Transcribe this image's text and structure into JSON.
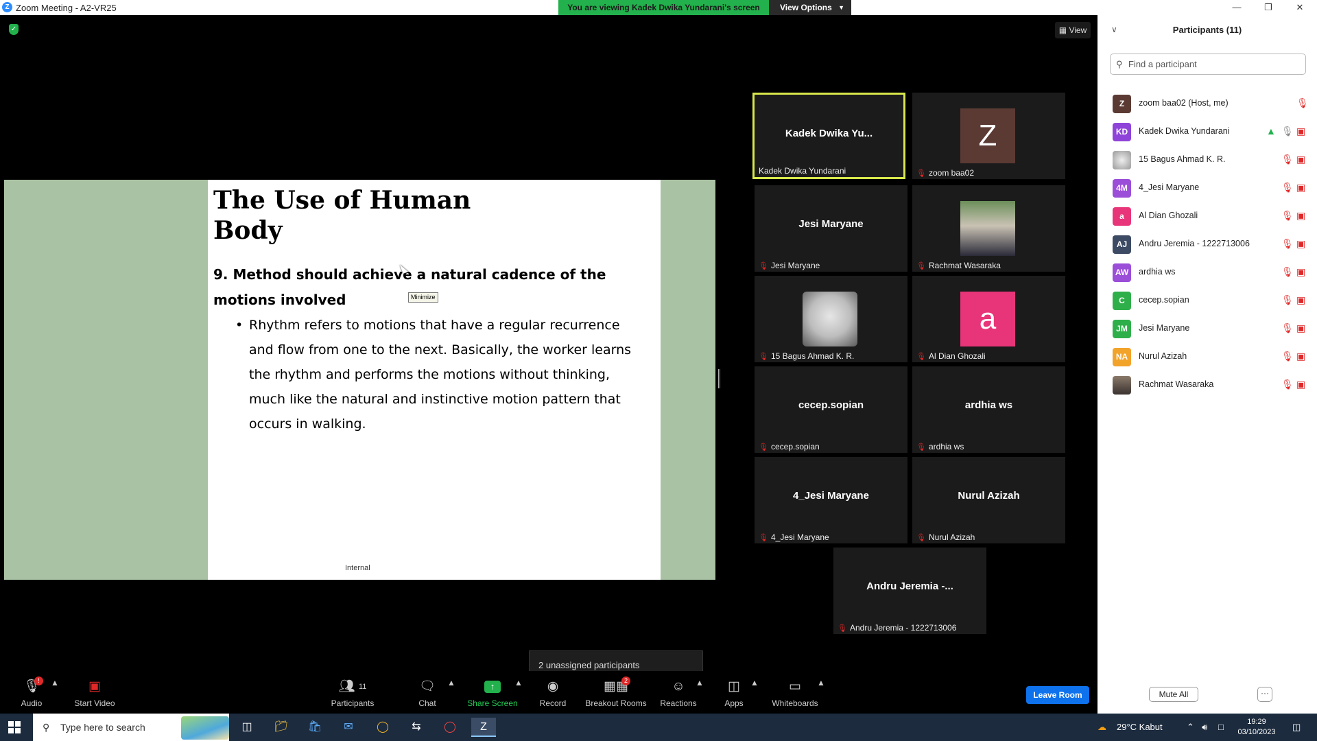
{
  "window": {
    "title": "Zoom Meeting - A2-VR25",
    "viewing_banner": "You are viewing Kadek Dwika Yundarani's screen",
    "view_options": "View Options"
  },
  "main": {
    "view_label": "View"
  },
  "slide": {
    "title": "The Use of Human Body",
    "subtitle": "9. Method should achieve a natural cadence of the motions involved",
    "bullet": "Rhythm refers to motions that have a regular recurrence and flow from one to the next. Basically, the worker learns the rhythm and performs the motions without thinking, much like the natural and instinctive motion pattern that occurs in walking.",
    "footer": "Internal",
    "tooltip": "Minimize"
  },
  "tiles": [
    {
      "display": "Kadek  Dwika  Yu...",
      "label": "Kadek Dwika Yundarani",
      "muted": false
    },
    {
      "display": "Z",
      "label": "zoom baa02",
      "muted": true,
      "avatar_color": "#5B3A33"
    },
    {
      "display": "Jesi Maryane",
      "label": "Jesi Maryane",
      "muted": true
    },
    {
      "display": "",
      "label": "Rachmat Wasaraka",
      "muted": true
    },
    {
      "display": "",
      "label": "15 Bagus Ahmad K. R.",
      "muted": true
    },
    {
      "display": "a",
      "label": "Al Dian Ghozali",
      "muted": true,
      "avatar_color": "#E8357A"
    },
    {
      "display": "cecep.sopian",
      "label": "cecep.sopian",
      "muted": true
    },
    {
      "display": "ardhia ws",
      "label": "ardhia ws",
      "muted": true
    },
    {
      "display": "4_Jesi Maryane",
      "label": "4_Jesi Maryane",
      "muted": true
    },
    {
      "display": "Nurul Azizah",
      "label": "Nurul Azizah",
      "muted": true
    },
    {
      "display": "Andru Jeremia -...",
      "label": "Andru Jeremia - 1222713006",
      "muted": true
    }
  ],
  "popup": {
    "unassigned": "2 unassigned participants"
  },
  "toolbar": {
    "audio": "Audio",
    "audio_badge": "!",
    "start_video": "Start Video",
    "participants": "Participants",
    "participants_count": "11",
    "chat": "Chat",
    "share_screen": "Share Screen",
    "record": "Record",
    "breakout": "Breakout Rooms",
    "breakout_badge": "2",
    "reactions": "Reactions",
    "apps": "Apps",
    "whiteboards": "Whiteboards",
    "leave": "Leave Room"
  },
  "panel": {
    "title": "Participants (11)",
    "search_placeholder": "Find a participant",
    "participants": [
      {
        "initials": "Z",
        "name": "zoom baa02 (Host, me)",
        "color": "#5B3A33"
      },
      {
        "initials": "KD",
        "name": "Kadek Dwika Yundarani",
        "color": "#8E44D8"
      },
      {
        "initials": "",
        "name": "15 Bagus Ahmad K. R.",
        "color": "#c9c9c9"
      },
      {
        "initials": "4M",
        "name": "4_Jesi Maryane",
        "color": "#9B4ED8"
      },
      {
        "initials": "a",
        "name": "Al Dian Ghozali",
        "color": "#E8357A"
      },
      {
        "initials": "AJ",
        "name": "Andru Jeremia - 1222713006",
        "color": "#3C4A63"
      },
      {
        "initials": "AW",
        "name": "ardhia ws",
        "color": "#9B4ED8"
      },
      {
        "initials": "C",
        "name": "cecep.sopian",
        "color": "#2FAF4A"
      },
      {
        "initials": "JM",
        "name": "Jesi Maryane",
        "color": "#2FAF4A"
      },
      {
        "initials": "NA",
        "name": "Nurul Azizah",
        "color": "#F2A32A"
      },
      {
        "initials": "",
        "name": "Rachmat Wasaraka",
        "color": "#6a5a50"
      }
    ],
    "mute_all": "Mute All",
    "more": "···"
  },
  "taskbar": {
    "search_placeholder": "Type here to search",
    "weather": "29°C  Kabut",
    "time": "19:29",
    "date": "03/10/2023"
  }
}
